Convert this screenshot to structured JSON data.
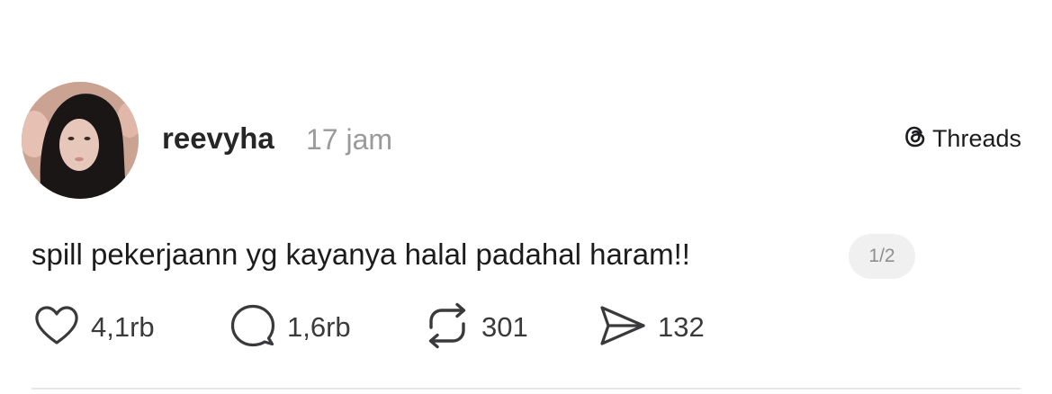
{
  "post": {
    "username": "reevyha",
    "timestamp": "17 jam",
    "text": "spill pekerjaann yg kayanya halal padahal haram!!",
    "page_indicator": "1/2"
  },
  "brand": {
    "icon": "threads-logo-icon",
    "name": "Threads"
  },
  "actions": {
    "likes": {
      "icon": "heart-icon",
      "count": "4,1rb"
    },
    "replies": {
      "icon": "comment-icon",
      "count": "1,6rb"
    },
    "reposts": {
      "icon": "repost-icon",
      "count": "301"
    },
    "shares": {
      "icon": "send-icon",
      "count": "132"
    }
  },
  "colors": {
    "text": "#1c1c1e",
    "muted": "#9a9a9a",
    "badge_bg": "#f0f0f0",
    "divider": "#e6e6e6"
  }
}
